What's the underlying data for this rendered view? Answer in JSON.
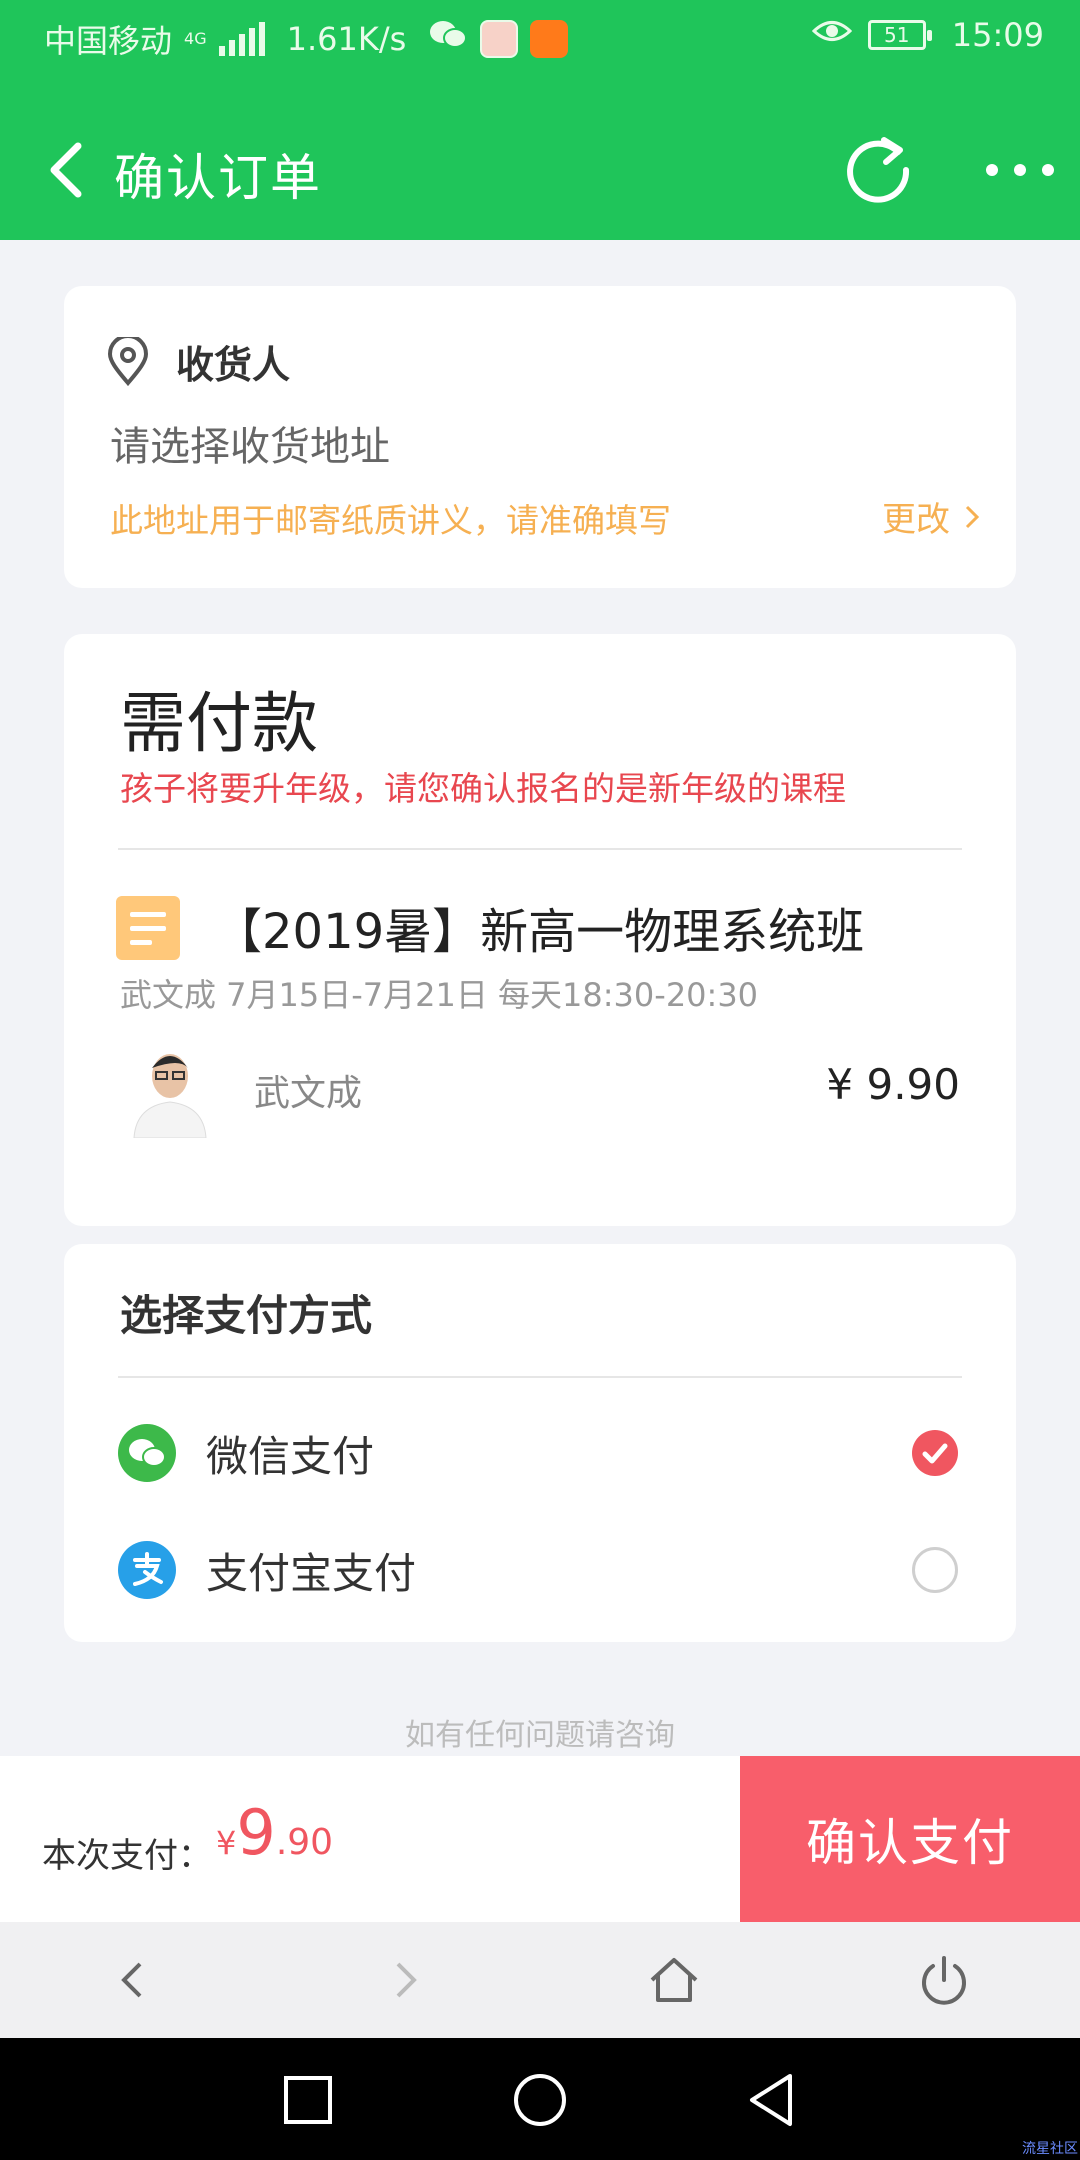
{
  "status_bar": {
    "carrier": "中国移动",
    "network": "4G",
    "speed": "1.61K/s",
    "battery": "51",
    "time": "15:09"
  },
  "header": {
    "title": "确认订单"
  },
  "address": {
    "title": "收货人",
    "select_prompt": "请选择收货地址",
    "note": "此地址用于邮寄纸质讲义，请准确填写",
    "change_label": "更改"
  },
  "payment": {
    "title": "需付款",
    "warning": "孩子将要升年级，请您确认报名的是新年级的课程",
    "course": {
      "name": "【2019暑】新高一物理系统班",
      "schedule": "武文成 7月15日-7月21日 每天18:30-20:30",
      "teacher": "武文成",
      "price": "¥ 9.90"
    }
  },
  "methods": {
    "title": "选择支付方式",
    "items": [
      {
        "label": "微信支付",
        "icon": "wechat-pay-icon",
        "selected": true
      },
      {
        "label": "支付宝支付",
        "icon": "alipay-icon",
        "selected": false
      }
    ]
  },
  "help_text": "如有任何问题请咨询",
  "paybar": {
    "label": "本次支付：",
    "currency": "¥",
    "amount_int": "9",
    "amount_dec": ".90",
    "confirm_label": "确认支付"
  },
  "watermark": "流星社区",
  "colors": {
    "brand_green": "#1fc55a",
    "accent_red": "#f05660",
    "warning_orange": "#f6b052",
    "confirm_red": "#f85e6b"
  }
}
